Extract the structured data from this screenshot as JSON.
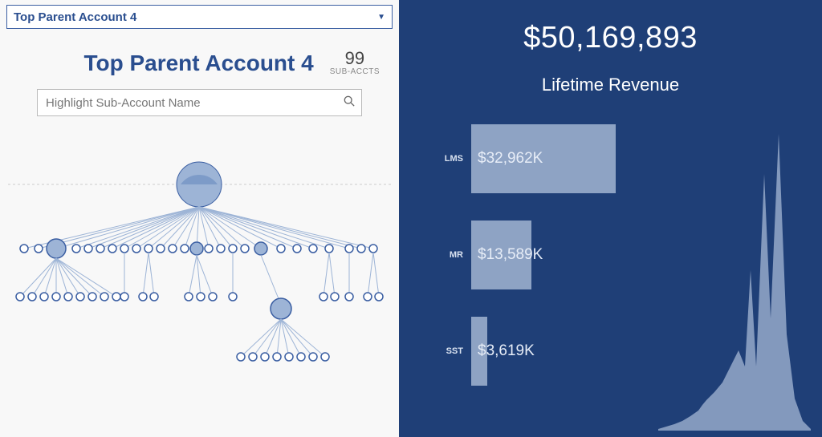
{
  "dropdown": {
    "selected": "Top Parent Account 4"
  },
  "header": {
    "title": "Top Parent Account 4",
    "sub_count": "99",
    "sub_label": "SUB-ACCTS"
  },
  "search": {
    "placeholder": "Highlight Sub-Account Name"
  },
  "right": {
    "total": "$50,169,893",
    "subtitle": "Lifetime Revenue"
  },
  "colors": {
    "panel_bg": "#1f3f77",
    "bar_fill": "#8ea3c4",
    "accent": "#2a4e8f"
  },
  "chart_data": [
    {
      "type": "bar",
      "title": "Lifetime Revenue",
      "orientation": "horizontal",
      "categories": [
        "LMS",
        "MR",
        "SST"
      ],
      "values": [
        32962,
        13589,
        3619
      ],
      "value_labels": [
        "$32,962K",
        "$13,589K",
        "$3,619K"
      ],
      "unit": "K USD"
    },
    {
      "type": "area",
      "title": "Revenue trend sparkline",
      "x": [
        0,
        1,
        2,
        3,
        4,
        5,
        6,
        7,
        8,
        9,
        10,
        11,
        12,
        13,
        14,
        15,
        16,
        17,
        18,
        19
      ],
      "values": [
        2,
        3,
        4,
        6,
        8,
        10,
        14,
        18,
        25,
        30,
        20,
        55,
        30,
        90,
        45,
        100,
        40,
        15,
        8,
        4
      ]
    },
    {
      "type": "hierarchy",
      "title": "Account hierarchy",
      "root": "Top Parent Account 4",
      "levels": 3,
      "total_nodes": 99
    }
  ]
}
